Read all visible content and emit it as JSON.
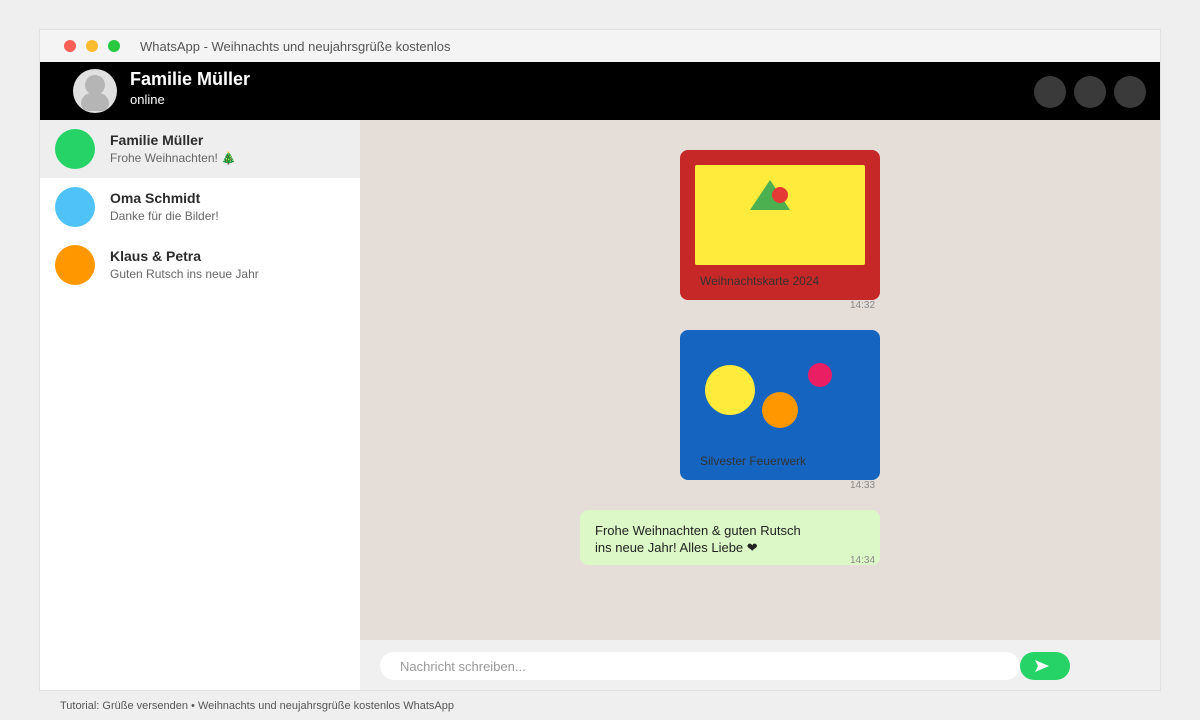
{
  "window": {
    "title": "WhatsApp - Weihnachts und neujahrsgrüße kostenlos"
  },
  "header": {
    "contact_name": "Familie Müller",
    "contact_status": "online",
    "action_buttons": [
      "header-action-1",
      "header-action-2",
      "header-action-3"
    ]
  },
  "sidebar": {
    "chats": [
      {
        "name": "Familie Müller",
        "preview": "Frohe Weihnachten! 🎄",
        "avatar_color": "#25d366",
        "active": true
      },
      {
        "name": "Oma Schmidt",
        "preview": "Danke für die Bilder!",
        "avatar_color": "#4fc3f7",
        "active": false
      },
      {
        "name": "Klaus & Petra",
        "preview": "Guten Rutsch ins neue Jahr",
        "avatar_color": "#ff9800",
        "active": false
      }
    ]
  },
  "messages": [
    {
      "type": "image",
      "caption": "Weihnachtskarte 2024",
      "time": "14:32",
      "bubble_color": "#c62828",
      "icon": "mountain-sun-image"
    },
    {
      "type": "image",
      "caption": "Silvester Feuerwerk",
      "time": "14:33",
      "bubble_color": "#1565c0",
      "icon": "fireworks-image"
    },
    {
      "type": "text",
      "lines": [
        "Frohe Weihnachten & guten Rutsch",
        "ins neue Jahr! Alles Liebe ❤"
      ],
      "time": "14:34",
      "bubble_color": "#dcf8c6"
    }
  ],
  "composer": {
    "placeholder": "Nachricht schreiben...",
    "value": "",
    "send_icon": "send-arrow-icon"
  },
  "colors": {
    "header_bg": "#000000",
    "chat_bg": "#e5ddd8",
    "accent": "#25d366"
  },
  "footer": {
    "caption": "Tutorial: Grüße versenden • Weihnachts und neujahrsgrüße kostenlos WhatsApp"
  }
}
